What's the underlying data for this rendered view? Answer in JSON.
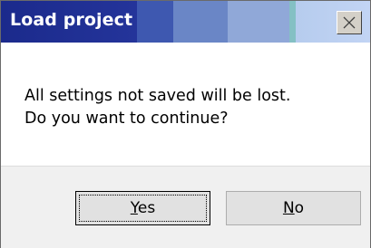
{
  "window": {
    "title": "Load project"
  },
  "message": {
    "line1": "All settings not saved will be lost.",
    "line2": "Do you want to continue?"
  },
  "buttons": {
    "yes": {
      "accel": "Y",
      "rest": "es"
    },
    "no": {
      "accel": "N",
      "rest": "o"
    }
  },
  "icons": {
    "close": "close-icon"
  },
  "colors": {
    "titlebar_left": "#1b2a8c",
    "titlebar_right": "#c2d4f4",
    "footer_bg": "#f0f0f0",
    "button_bg": "#e1e1e1"
  }
}
